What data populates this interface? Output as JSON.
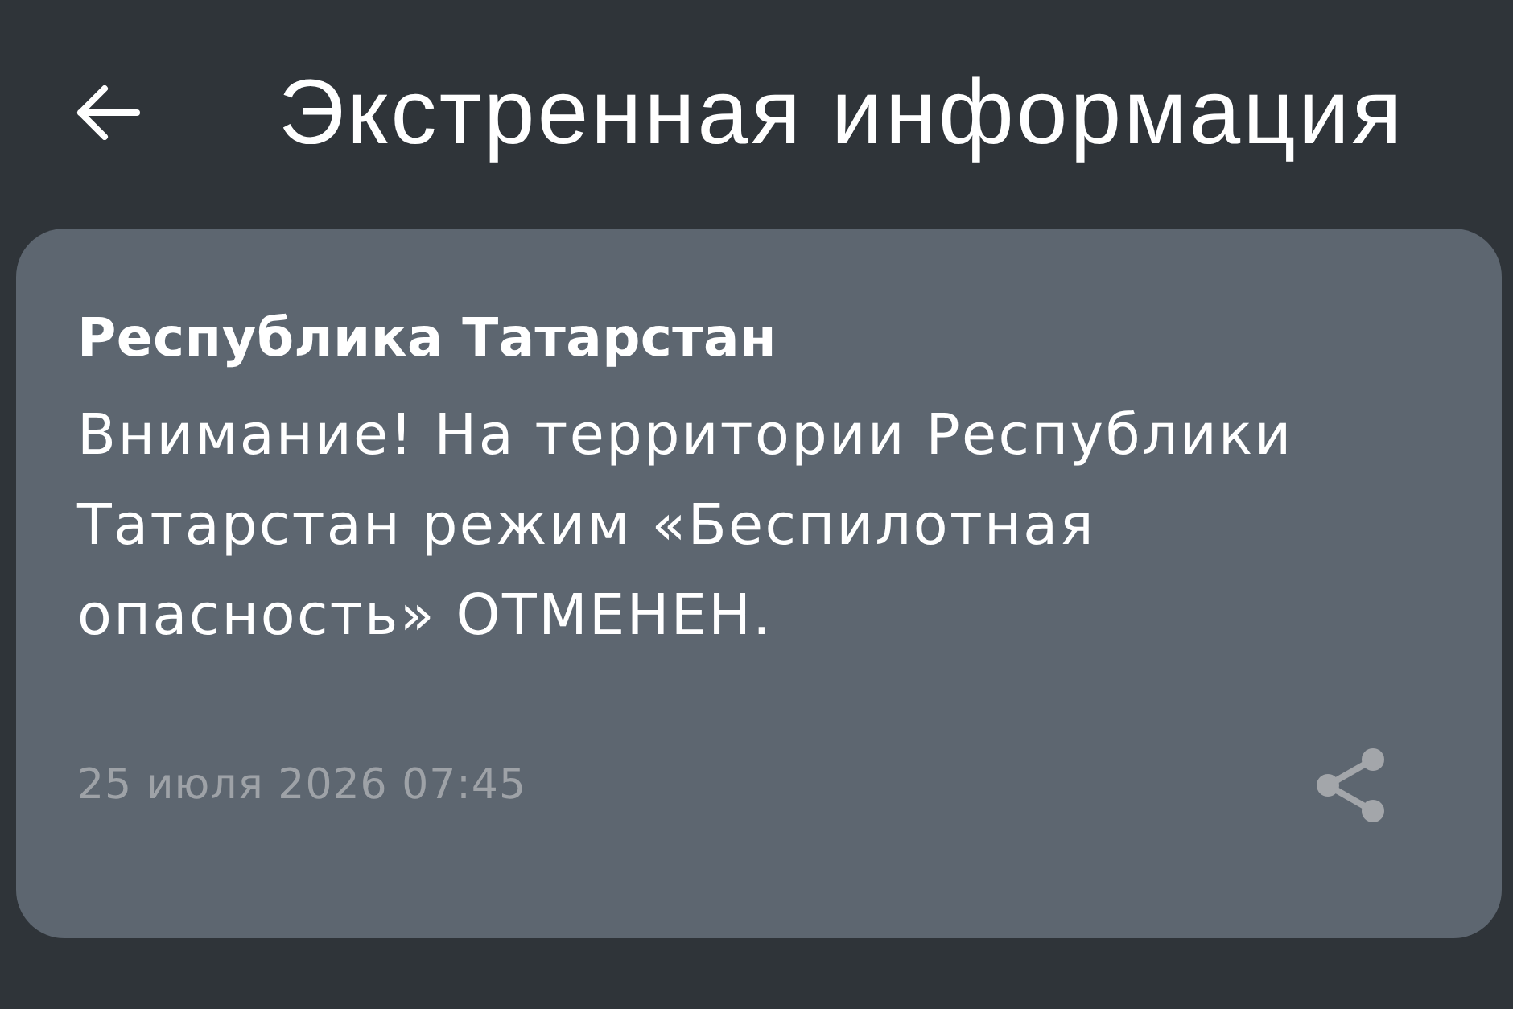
{
  "header": {
    "title": "Экстренная информация"
  },
  "alert": {
    "region": "Республика Татарстан",
    "message": "Внимание! На территории Республики Татарстан режим «Беспилотная опасность» ОТМЕНЕН.",
    "date": "25 июля 2026 07:45"
  }
}
